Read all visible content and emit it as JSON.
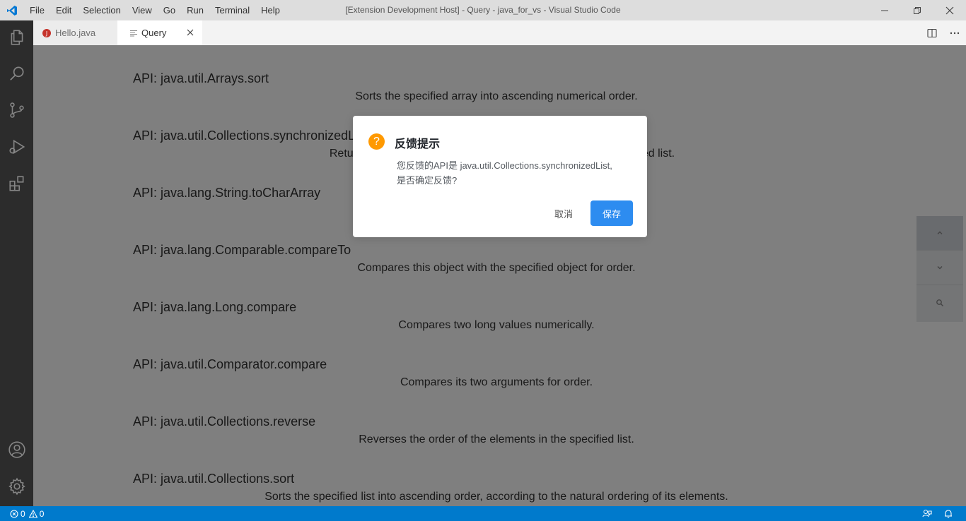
{
  "window": {
    "title": "[Extension Development Host] - Query - java_for_vs - Visual Studio Code"
  },
  "menu": [
    "File",
    "Edit",
    "Selection",
    "View",
    "Go",
    "Run",
    "Terminal",
    "Help"
  ],
  "tabs": [
    {
      "label": "Hello.java",
      "icon": "java-file-icon",
      "active": false
    },
    {
      "label": "Query",
      "icon": "preview-icon",
      "active": true
    }
  ],
  "apis": [
    {
      "title": "API: java.util.Arrays.sort",
      "desc": "Sorts the specified array into ascending numerical order."
    },
    {
      "title": "API: java.util.Collections.synchronizedList",
      "desc": "Returns a synchronized (thread-safe) list backed by the specified list."
    },
    {
      "title": "API: java.lang.String.toCharArray",
      "desc": ""
    },
    {
      "title": "API: java.lang.Comparable.compareTo",
      "desc": "Compares this object with the specified object for order."
    },
    {
      "title": "API: java.lang.Long.compare",
      "desc": "Compares two long values numerically."
    },
    {
      "title": "API: java.util.Comparator.compare",
      "desc": "Compares its two arguments for order."
    },
    {
      "title": "API: java.util.Collections.reverse",
      "desc": "Reverses the order of the elements in the specified list."
    },
    {
      "title": "API: java.util.Collections.sort",
      "desc": "Sorts the specified list into ascending order, according to the natural ordering of its elements."
    }
  ],
  "dialog": {
    "title": "反馈提示",
    "message_line1": "您反馈的API是 java.util.Collections.synchronizedList,",
    "message_line2": "是否确定反馈?",
    "cancel": "取消",
    "ok": "保存",
    "accent": "#2d8cf0",
    "warn_color": "#ff9900",
    "warn_glyph": "?"
  },
  "status": {
    "errors": "0",
    "warnings": "0"
  },
  "colors": {
    "statusbar": "#007acc",
    "activitybar": "#2c2c2c"
  }
}
